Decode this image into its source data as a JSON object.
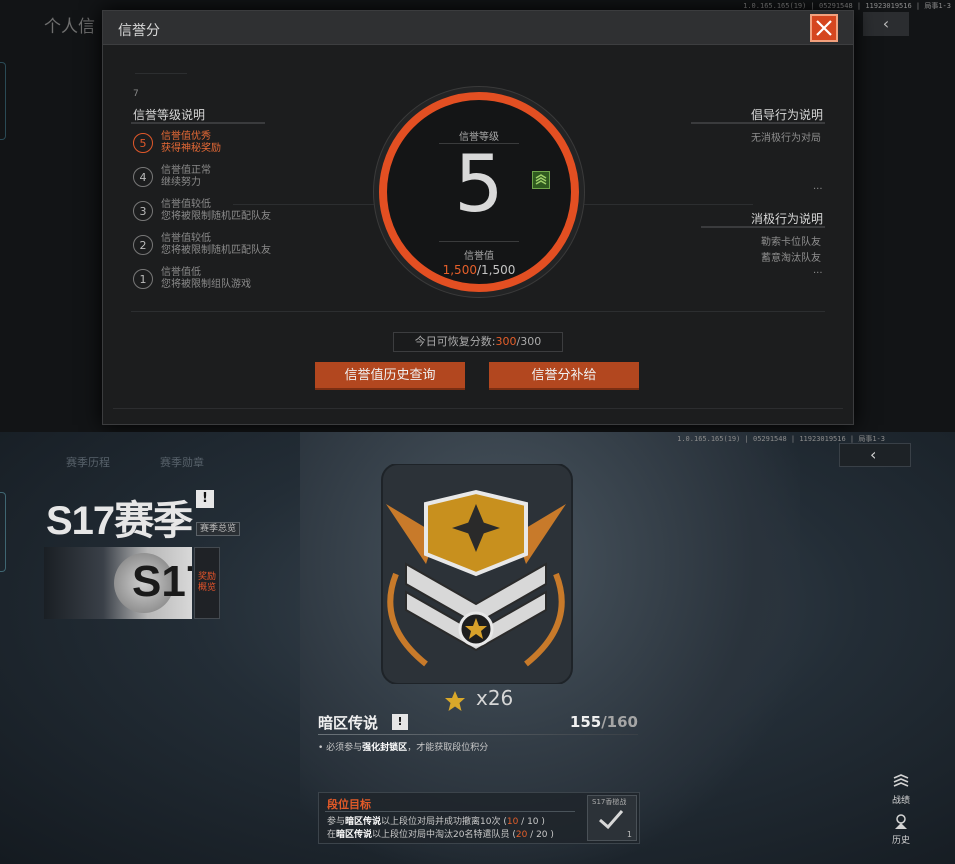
{
  "top": {
    "build_info": "1.0.165.165(19) | 05291548 | 11923019516 | 局事1-3",
    "bg_title": "个人信",
    "back_icon": "‹",
    "modal": {
      "title": "信誉分",
      "close_icon": "close-icon",
      "faint_number": "7",
      "levels_title": "信誉等级说明",
      "levels": [
        {
          "num": "5",
          "line1": "信誉值优秀",
          "line2": "获得神秘奖励",
          "active": true
        },
        {
          "num": "4",
          "line1": "信誉值正常",
          "line2": "继续努力",
          "active": false
        },
        {
          "num": "3",
          "line1": "信誉值较低",
          "line2": "您将被限制随机匹配队友",
          "active": false
        },
        {
          "num": "2",
          "line1": "信誉值较低",
          "line2": "您将被限制随机匹配队友",
          "active": false
        },
        {
          "num": "1",
          "line1": "信誉值低",
          "line2": "您将被限制组队游戏",
          "active": false
        }
      ],
      "ring_label_top": "信誉等级",
      "level_value": "5",
      "ring_label_bottom": "信誉值",
      "score_current": "1,500",
      "score_sep": "/",
      "score_max": "1,500",
      "positive_title": "倡导行为说明",
      "positive_items": [
        "无消极行为对局"
      ],
      "positive_more": "...",
      "negative_title": "消极行为说明",
      "negative_items": [
        "勒索卡位队友",
        "蓄意淘汰队友"
      ],
      "negative_more": "...",
      "recover_label": "今日可恢复分数:",
      "recover_current": "300",
      "recover_max": "/300",
      "btn_history": "信誉值历史查询",
      "btn_supplement": "信誉分补给",
      "accent": "#e34f22"
    }
  },
  "bottom": {
    "build_info": "1.0.165.165(19) | 05291548 | 11923019516 | 局事1-3",
    "tabs": [
      "赛季历程",
      "赛季勋章"
    ],
    "back_icon": "‹",
    "season_title": "S17赛季",
    "warn_mark": "!",
    "season_overview": "赛季总览",
    "banner_text": "S17",
    "reward_btn": "奖励概览",
    "badge_icon": "sergeant-rank-badge-icon",
    "star_count": "x26",
    "rank_name": "暗区传说",
    "rank_score_current": "155",
    "rank_score_max": "/160",
    "rank_note_prefix": "• 必须参与",
    "rank_note_bold": "强化封锁区",
    "rank_note_suffix": "，才能获取段位积分",
    "goal": {
      "title": "段位目标",
      "items": [
        {
          "prefix": "参与",
          "bold": "暗区传说",
          "suffix": "以上段位对局并成功撤离10次 (",
          "current": "10",
          "max": " / 10 )"
        },
        {
          "prefix": "在",
          "bold": "暗区传说",
          "suffix": "以上段位对局中淘汰20名特遣队员 (",
          "current": "20",
          "max": " / 20 )"
        }
      ],
      "reward_label": "S17香槌战",
      "reward_qty": "1"
    },
    "side_buttons": [
      {
        "label": "战绩",
        "icon": "record-icon"
      },
      {
        "label": "历史",
        "icon": "history-icon"
      }
    ]
  }
}
